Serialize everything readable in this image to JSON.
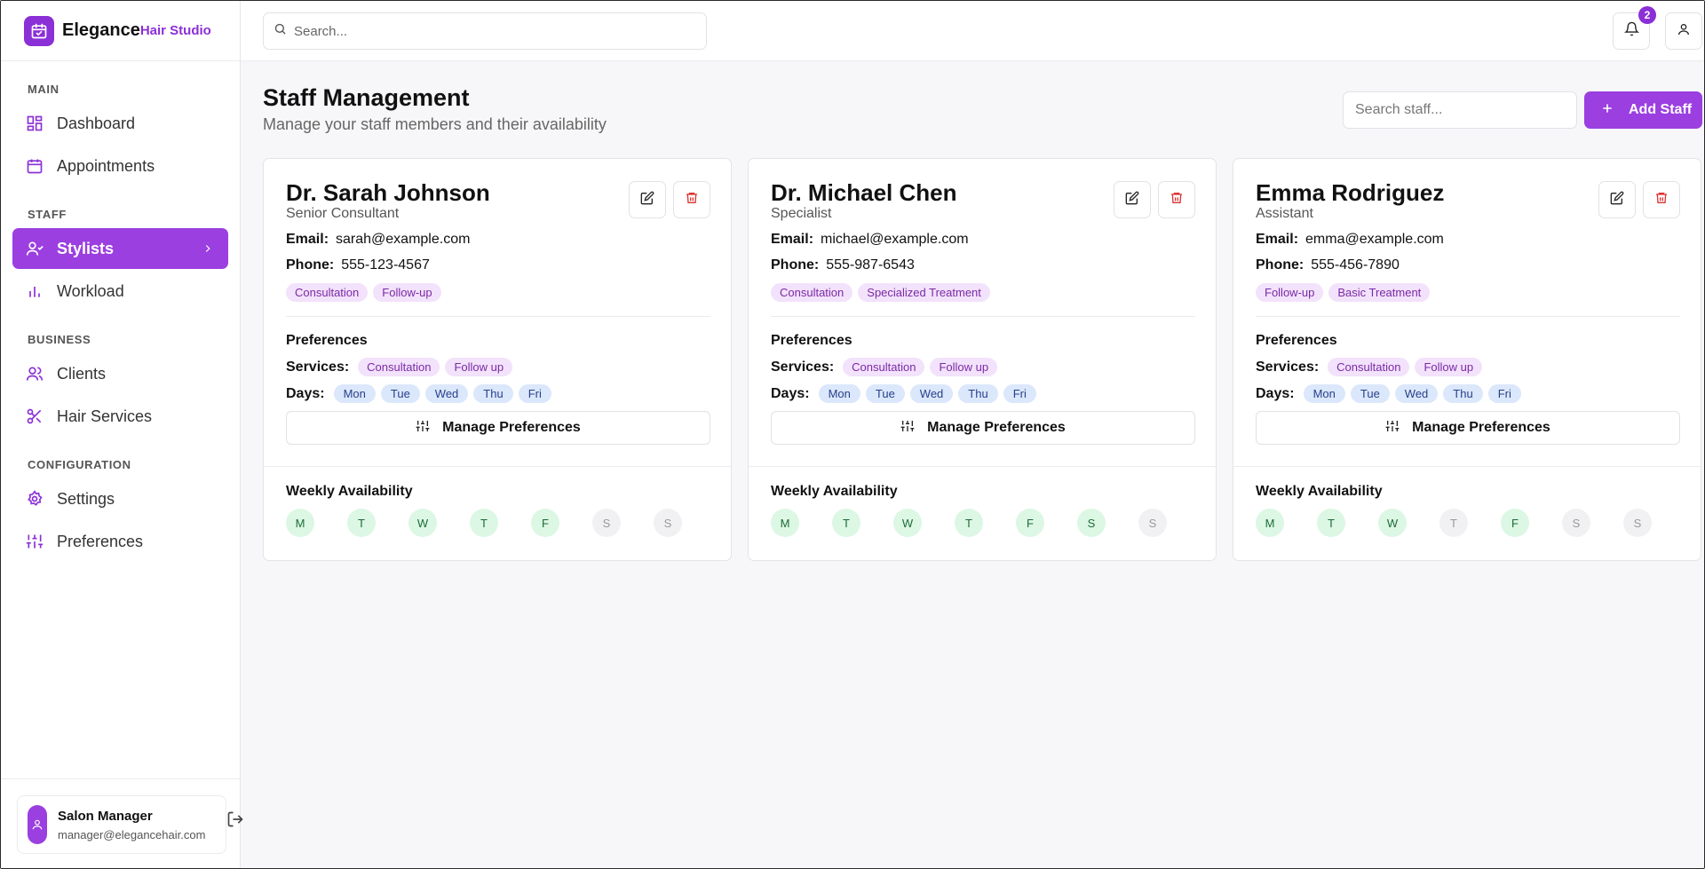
{
  "brand": {
    "name": "Elegance",
    "sub": "Hair Studio"
  },
  "sidebar": {
    "sections": [
      {
        "title": "MAIN",
        "items": [
          {
            "label": "Dashboard",
            "icon": "dashboard-icon"
          },
          {
            "label": "Appointments",
            "icon": "calendar-icon"
          }
        ]
      },
      {
        "title": "STAFF",
        "items": [
          {
            "label": "Stylists",
            "icon": "user-icon",
            "active": true
          },
          {
            "label": "Workload",
            "icon": "bar-chart-icon"
          }
        ]
      },
      {
        "title": "BUSINESS",
        "items": [
          {
            "label": "Clients",
            "icon": "users-icon"
          },
          {
            "label": "Hair Services",
            "icon": "scissors-icon"
          }
        ]
      },
      {
        "title": "CONFIGURATION",
        "items": [
          {
            "label": "Settings",
            "icon": "gear-icon"
          },
          {
            "label": "Preferences",
            "icon": "sliders-icon"
          }
        ]
      }
    ],
    "user": {
      "name": "Salon Manager",
      "email": "manager@elegancehair.com"
    }
  },
  "topbar": {
    "search_placeholder": "Search...",
    "notification_count": "2"
  },
  "page": {
    "title": "Staff Management",
    "subtitle": "Manage your staff members and their availability",
    "search_placeholder": "Search staff...",
    "add_label": "Add Staff"
  },
  "labels": {
    "email": "Email:",
    "phone": "Phone:",
    "preferences": "Preferences",
    "services": "Services:",
    "days": "Days:",
    "manage": "Manage Preferences",
    "weekly": "Weekly Availability"
  },
  "colors": {
    "accent": "#9b3fe0",
    "available": "#dcf7e4",
    "unavailable": "#f1f1f3",
    "tag": "#f3e2fb",
    "day_tag": "#dbe7fb"
  },
  "staff": [
    {
      "name": "Dr. Sarah Johnson",
      "role": "Senior Consultant",
      "email": "sarah@example.com",
      "phone": "555-123-4567",
      "tags": [
        "Consultation",
        "Follow-up"
      ],
      "pref_services": [
        "Consultation",
        "Follow up"
      ],
      "pref_days": [
        "Mon",
        "Tue",
        "Wed",
        "Thu",
        "Fri"
      ],
      "availability": [
        {
          "day": "M",
          "available": true
        },
        {
          "day": "T",
          "available": true
        },
        {
          "day": "W",
          "available": true
        },
        {
          "day": "T",
          "available": true
        },
        {
          "day": "F",
          "available": true
        },
        {
          "day": "S",
          "available": false
        },
        {
          "day": "S",
          "available": false
        }
      ]
    },
    {
      "name": "Dr. Michael Chen",
      "role": "Specialist",
      "email": "michael@example.com",
      "phone": "555-987-6543",
      "tags": [
        "Consultation",
        "Specialized Treatment"
      ],
      "pref_services": [
        "Consultation",
        "Follow up"
      ],
      "pref_days": [
        "Mon",
        "Tue",
        "Wed",
        "Thu",
        "Fri"
      ],
      "availability": [
        {
          "day": "M",
          "available": true
        },
        {
          "day": "T",
          "available": true
        },
        {
          "day": "W",
          "available": true
        },
        {
          "day": "T",
          "available": true
        },
        {
          "day": "F",
          "available": true
        },
        {
          "day": "S",
          "available": true
        },
        {
          "day": "S",
          "available": false
        }
      ]
    },
    {
      "name": "Emma Rodriguez",
      "role": "Assistant",
      "email": "emma@example.com",
      "phone": "555-456-7890",
      "tags": [
        "Follow-up",
        "Basic Treatment"
      ],
      "pref_services": [
        "Consultation",
        "Follow up"
      ],
      "pref_days": [
        "Mon",
        "Tue",
        "Wed",
        "Thu",
        "Fri"
      ],
      "availability": [
        {
          "day": "M",
          "available": true
        },
        {
          "day": "T",
          "available": true
        },
        {
          "day": "W",
          "available": true
        },
        {
          "day": "T",
          "available": false
        },
        {
          "day": "F",
          "available": true
        },
        {
          "day": "S",
          "available": false
        },
        {
          "day": "S",
          "available": false
        }
      ]
    }
  ]
}
